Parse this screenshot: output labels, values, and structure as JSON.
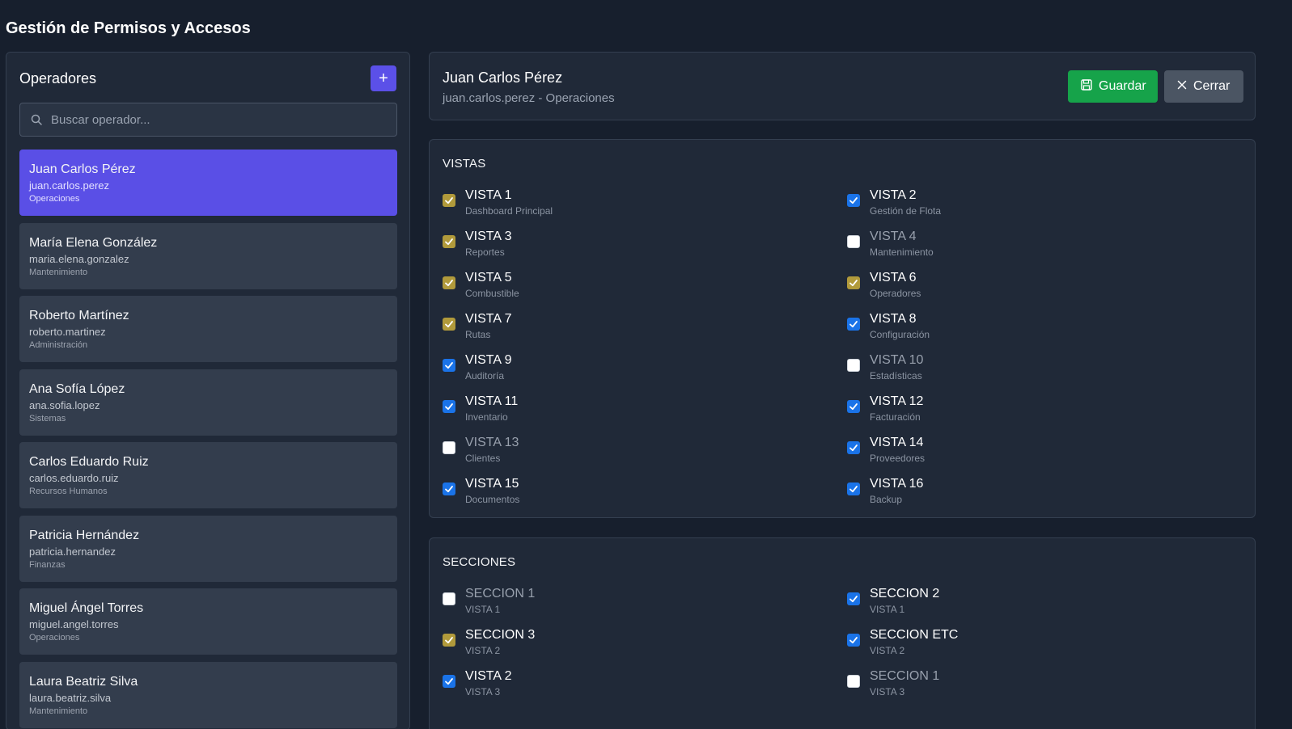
{
  "page": {
    "title": "Gestión de Permisos y Accesos"
  },
  "operators_panel": {
    "title": "Operadores",
    "add_label": "+",
    "search_placeholder": "Buscar operador...",
    "items": [
      {
        "name": "Juan Carlos Pérez",
        "username": "juan.carlos.perez",
        "department": "Operaciones",
        "selected": true
      },
      {
        "name": "María Elena González",
        "username": "maria.elena.gonzalez",
        "department": "Mantenimiento",
        "selected": false
      },
      {
        "name": "Roberto Martínez",
        "username": "roberto.martinez",
        "department": "Administración",
        "selected": false
      },
      {
        "name": "Ana Sofía López",
        "username": "ana.sofia.lopez",
        "department": "Sistemas",
        "selected": false
      },
      {
        "name": "Carlos Eduardo Ruiz",
        "username": "carlos.eduardo.ruiz",
        "department": "Recursos Humanos",
        "selected": false
      },
      {
        "name": "Patricia Hernández",
        "username": "patricia.hernandez",
        "department": "Finanzas",
        "selected": false
      },
      {
        "name": "Miguel Ángel Torres",
        "username": "miguel.angel.torres",
        "department": "Operaciones",
        "selected": false
      },
      {
        "name": "Laura Beatriz Silva",
        "username": "laura.beatriz.silva",
        "department": "Mantenimiento",
        "selected": false
      }
    ]
  },
  "detail": {
    "name": "Juan Carlos Pérez",
    "subtitle": "juan.carlos.perez - Operaciones",
    "save_label": "Guardar",
    "close_label": "Cerrar"
  },
  "vistas": {
    "title": "VISTAS",
    "items": [
      {
        "label": "VISTA 1",
        "desc": "Dashboard Principal",
        "state": "partial"
      },
      {
        "label": "VISTA 2",
        "desc": "Gestión de Flota",
        "state": "on"
      },
      {
        "label": "VISTA 3",
        "desc": "Reportes",
        "state": "partial"
      },
      {
        "label": "VISTA 4",
        "desc": "Mantenimiento",
        "state": "off"
      },
      {
        "label": "VISTA 5",
        "desc": "Combustible",
        "state": "partial"
      },
      {
        "label": "VISTA 6",
        "desc": "Operadores",
        "state": "partial"
      },
      {
        "label": "VISTA 7",
        "desc": "Rutas",
        "state": "partial"
      },
      {
        "label": "VISTA 8",
        "desc": "Configuración",
        "state": "on"
      },
      {
        "label": "VISTA 9",
        "desc": "Auditoría",
        "state": "on"
      },
      {
        "label": "VISTA 10",
        "desc": "Estadísticas",
        "state": "off"
      },
      {
        "label": "VISTA 11",
        "desc": "Inventario",
        "state": "on"
      },
      {
        "label": "VISTA 12",
        "desc": "Facturación",
        "state": "on"
      },
      {
        "label": "VISTA 13",
        "desc": "Clientes",
        "state": "off"
      },
      {
        "label": "VISTA 14",
        "desc": "Proveedores",
        "state": "on"
      },
      {
        "label": "VISTA 15",
        "desc": "Documentos",
        "state": "on"
      },
      {
        "label": "VISTA 16",
        "desc": "Backup",
        "state": "on"
      }
    ]
  },
  "secciones": {
    "title": "SECCIONES",
    "items": [
      {
        "label": "SECCION 1",
        "desc": "VISTA 1",
        "state": "off"
      },
      {
        "label": "SECCION 2",
        "desc": "VISTA 1",
        "state": "on"
      },
      {
        "label": "SECCION 3",
        "desc": "VISTA 2",
        "state": "partial"
      },
      {
        "label": "SECCION ETC",
        "desc": "VISTA 2",
        "state": "on"
      },
      {
        "label": "VISTA 2",
        "desc": "VISTA 3",
        "state": "on"
      },
      {
        "label": "SECCION 1",
        "desc": "VISTA 3",
        "state": "off"
      }
    ]
  },
  "colors": {
    "accent": "#5b50e8",
    "save": "#16a34a",
    "close": "#4b5563",
    "checkbox_on": "#1a73e8",
    "checkbox_partial": "#b19a3b",
    "background": "#171f2d",
    "panel": "#202938"
  },
  "icons": {
    "search": "search-icon",
    "add": "plus-icon",
    "save": "save-icon",
    "close": "close-icon",
    "check": "check-icon"
  }
}
